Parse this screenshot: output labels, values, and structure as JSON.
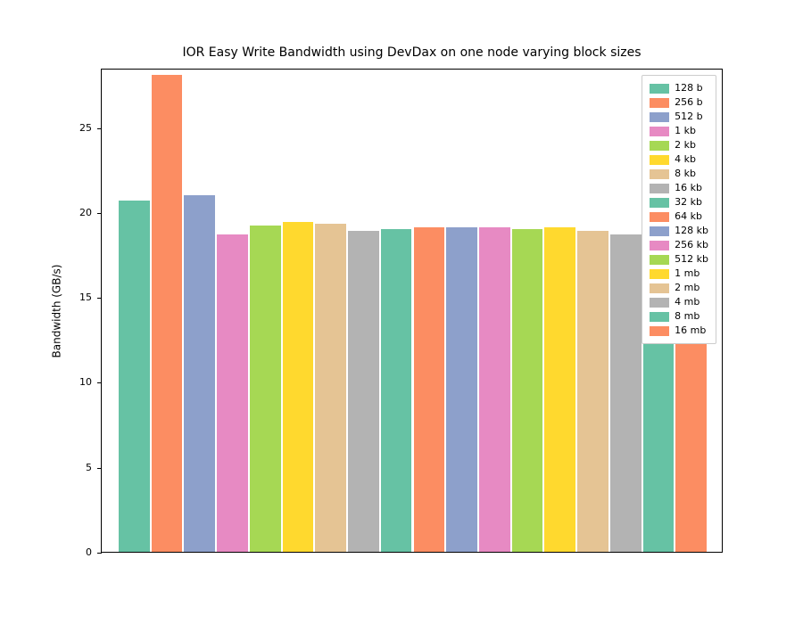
{
  "chart_data": {
    "type": "bar",
    "title": "IOR Easy Write Bandwidth using DevDax on one node varying block sizes",
    "xlabel": "",
    "ylabel": "Bandwidth (GB/s)",
    "ylim": [
      0,
      28.5
    ],
    "yticks": [
      0,
      5,
      10,
      15,
      20,
      25
    ],
    "legend_position": "upper right",
    "categories": [
      "128 b",
      "256 b",
      "512 b",
      "1 kb",
      "2 kb",
      "4 kb",
      "8 kb",
      "16 kb",
      "32 kb",
      "64 kb",
      "128 kb",
      "256 kb",
      "512 kb",
      "1 mb",
      "2 mb",
      "4 mb",
      "8 mb",
      "16 mb"
    ],
    "values": [
      20.7,
      28.1,
      21.0,
      18.7,
      19.2,
      19.4,
      19.3,
      18.9,
      19.0,
      19.1,
      19.1,
      19.1,
      19.0,
      19.1,
      18.9,
      18.7,
      18.7,
      18.9
    ],
    "colors": [
      "#66c2a4",
      "#fc8d62",
      "#8da0cb",
      "#e78ac3",
      "#a6d854",
      "#ffd92e",
      "#e5c494",
      "#b3b3b3",
      "#66c2a4",
      "#fc8d62",
      "#8da0cb",
      "#e78ac3",
      "#a6d854",
      "#ffd92e",
      "#e5c494",
      "#b3b3b3",
      "#66c2a4",
      "#fc8d62"
    ]
  }
}
